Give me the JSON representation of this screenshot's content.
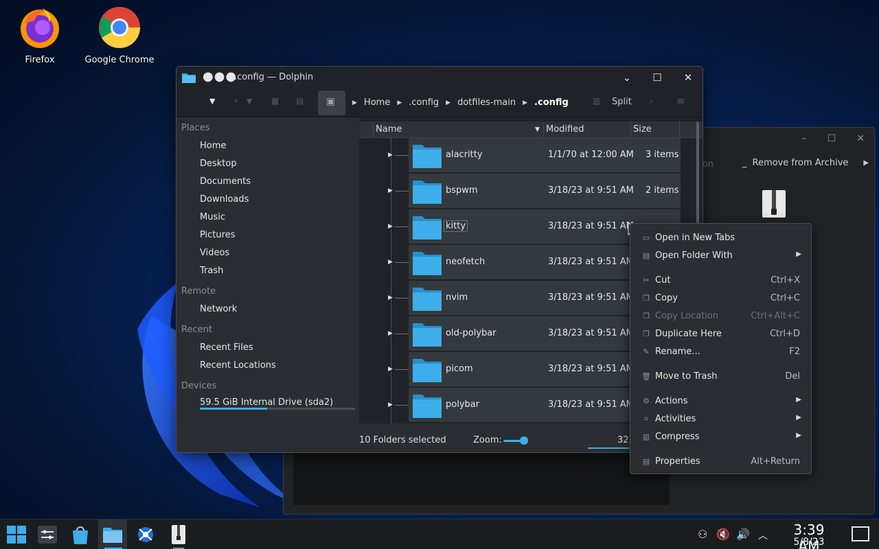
{
  "desktop": {
    "icons": [
      {
        "label": "Firefox"
      },
      {
        "label": "Google Chrome"
      }
    ]
  },
  "archive_window": {
    "toolbar_partial": "ion",
    "remove_label": "Remove from Archive"
  },
  "dolphin": {
    "title": ".config — Dolphin",
    "breadcrumb": [
      "Home",
      ".config",
      "dotfiles-main",
      ".config"
    ],
    "split_label": "Split",
    "sidebar": {
      "places_header": "Places",
      "places": [
        "Home",
        "Desktop",
        "Documents",
        "Downloads",
        "Music",
        "Pictures",
        "Videos",
        "Trash"
      ],
      "remote_header": "Remote",
      "remote": [
        "Network"
      ],
      "recent_header": "Recent",
      "recent": [
        "Recent Files",
        "Recent Locations"
      ],
      "devices_header": "Devices",
      "devices": [
        "59.5 GiB Internal Drive (sda2)"
      ],
      "drive_usage_fraction": 0.43
    },
    "columns": {
      "name": "Name",
      "modified": "Modified",
      "size": "Size"
    },
    "rows": [
      {
        "name": "alacritty",
        "modified": "1/1/70 at 12:00 AM",
        "size": "3 items"
      },
      {
        "name": "bspwm",
        "modified": "3/18/23 at 9:51 AM",
        "size": "2 items"
      },
      {
        "name": "kitty",
        "modified": "3/18/23 at 9:51 AM",
        "size": ""
      },
      {
        "name": "neofetch",
        "modified": "3/18/23 at 9:51 AM",
        "size": ""
      },
      {
        "name": "nvim",
        "modified": "3/18/23 at 9:51 AM",
        "size": ""
      },
      {
        "name": "old-polybar",
        "modified": "3/18/23 at 9:51 AM",
        "size": ""
      },
      {
        "name": "picom",
        "modified": "3/18/23 at 9:51 AM",
        "size": ""
      },
      {
        "name": "polybar",
        "modified": "3/18/23 at 9:51 AM",
        "size": ""
      }
    ],
    "status": {
      "selection": "10 Folders selected",
      "zoom_label": "Zoom:",
      "free_partial": "32."
    }
  },
  "context_menu": {
    "items": [
      {
        "label": "Open in New Tabs",
        "shortcut": "",
        "submenu": false,
        "disabled": false,
        "icon": "tabs-icon"
      },
      {
        "label": "Open Folder With",
        "shortcut": "",
        "submenu": true,
        "disabled": false,
        "icon": "open-with-icon"
      },
      {
        "label": "Cut",
        "shortcut": "Ctrl+X",
        "submenu": false,
        "disabled": false,
        "icon": "cut-icon"
      },
      {
        "label": "Copy",
        "shortcut": "Ctrl+C",
        "submenu": false,
        "disabled": false,
        "icon": "copy-icon"
      },
      {
        "label": "Copy Location",
        "shortcut": "Ctrl+Alt+C",
        "submenu": false,
        "disabled": true,
        "icon": "copy-location-icon"
      },
      {
        "label": "Duplicate Here",
        "shortcut": "Ctrl+D",
        "submenu": false,
        "disabled": false,
        "icon": "duplicate-icon"
      },
      {
        "label": "Rename...",
        "shortcut": "F2",
        "submenu": false,
        "disabled": false,
        "icon": "rename-icon"
      },
      {
        "label": "Move to Trash",
        "shortcut": "Del",
        "submenu": false,
        "disabled": false,
        "icon": "trash-icon"
      },
      {
        "label": "Actions",
        "shortcut": "",
        "submenu": true,
        "disabled": false,
        "icon": "actions-icon"
      },
      {
        "label": "Activities",
        "shortcut": "",
        "submenu": true,
        "disabled": false,
        "icon": "activities-icon"
      },
      {
        "label": "Compress",
        "shortcut": "",
        "submenu": true,
        "disabled": false,
        "icon": "compress-icon"
      },
      {
        "label": "Properties",
        "shortcut": "Alt+Return",
        "submenu": false,
        "disabled": false,
        "icon": "properties-icon"
      }
    ]
  },
  "taskbar": {
    "time": "3:39 AM",
    "date": "5/8/23"
  },
  "colors": {
    "accent": "#3daee9",
    "folder": "#3daee9",
    "panel": "#2a2e32"
  }
}
